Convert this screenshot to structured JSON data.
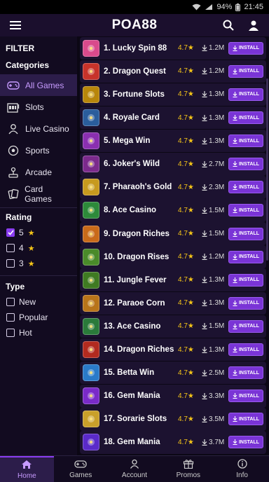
{
  "status_bar": {
    "battery": "94%",
    "time": "21:45"
  },
  "header": {
    "title": "POA88",
    "menu_icon": "hamburger-icon",
    "search_icon": "search-icon",
    "user_icon": "user-icon"
  },
  "sidebar": {
    "filter_heading": "FILTER",
    "categories_heading": "Categories",
    "categories": [
      {
        "label": "All Games",
        "icon": "gamepad-icon",
        "active": true
      },
      {
        "label": "Slots",
        "icon": "slot-machine-icon",
        "active": false
      },
      {
        "label": "Live Casino",
        "icon": "dealer-icon",
        "active": false
      },
      {
        "label": "Sports",
        "icon": "soccer-ball-icon",
        "active": false
      },
      {
        "label": "Arcade",
        "icon": "joystick-icon",
        "active": false
      },
      {
        "label": "Card Games",
        "icon": "cards-icon",
        "active": false
      }
    ],
    "rating_heading": "Rating",
    "ratings": [
      {
        "label": "5",
        "checked": true
      },
      {
        "label": "4",
        "checked": false
      },
      {
        "label": "3",
        "checked": false
      }
    ],
    "type_heading": "Type",
    "types": [
      {
        "label": "New",
        "checked": false
      },
      {
        "label": "Popular",
        "checked": false
      },
      {
        "label": "Hot",
        "checked": false
      }
    ]
  },
  "games": [
    {
      "name": "1. Lucky Spin 88",
      "rating": "4.7",
      "downloads": "1.2M",
      "install_label": "INSTALL",
      "thumb_color": "#d94a8c"
    },
    {
      "name": "2. Dragon Quest",
      "rating": "4.7",
      "downloads": "1.2M",
      "install_label": "INSTALL",
      "thumb_color": "#c7332a"
    },
    {
      "name": "3. Fortune Slots",
      "rating": "4.7",
      "downloads": "1.3M",
      "install_label": "INSTALL",
      "thumb_color": "#b8860b"
    },
    {
      "name": "4. Royale Card",
      "rating": "4.7",
      "downloads": "1.3M",
      "install_label": "INSTALL",
      "thumb_color": "#2a5d9c"
    },
    {
      "name": "5. Mega Win",
      "rating": "4.7",
      "downloads": "1.3M",
      "install_label": "INSTALL",
      "thumb_color": "#8a2fb0"
    },
    {
      "name": "6. Joker's Wild",
      "rating": "4.7",
      "downloads": "2.7M",
      "install_label": "INSTALL",
      "thumb_color": "#7b2a8c"
    },
    {
      "name": "7. Pharaoh's Gold",
      "rating": "4.7",
      "downloads": "2.3M",
      "install_label": "INSTALL",
      "thumb_color": "#c79a1f"
    },
    {
      "name": "8. Ace Casino",
      "rating": "4.7",
      "downloads": "1.5M",
      "install_label": "INSTALL",
      "thumb_color": "#2d8a3a"
    },
    {
      "name": "9. Dragon Riches",
      "rating": "4.7",
      "downloads": "1.5M",
      "install_label": "INSTALL",
      "thumb_color": "#c96a1a"
    },
    {
      "name": "10. Dragon Rises",
      "rating": "4.7",
      "downloads": "1.2M",
      "install_label": "INSTALL",
      "thumb_color": "#4a8a2a"
    },
    {
      "name": "11. Jungle Fever",
      "rating": "4.7",
      "downloads": "1.3M",
      "install_label": "INSTALL",
      "thumb_color": "#3f7a22"
    },
    {
      "name": "12. Paraoe Corn",
      "rating": "4.7",
      "downloads": "1.3M",
      "install_label": "INSTALL",
      "thumb_color": "#b8741a"
    },
    {
      "name": "13. Ace Casino",
      "rating": "4.7",
      "downloads": "1.5M",
      "install_label": "INSTALL",
      "thumb_color": "#2a7a3a"
    },
    {
      "name": "14. Dragon Riches",
      "rating": "4.7",
      "downloads": "1.3M",
      "install_label": "INSTALL",
      "thumb_color": "#b22a1f"
    },
    {
      "name": "15. Betta Win",
      "rating": "4.7",
      "downloads": "2.5M",
      "install_label": "INSTALL",
      "thumb_color": "#2a7ac9"
    },
    {
      "name": "16. Gem Mania",
      "rating": "4.7",
      "downloads": "3.3M",
      "install_label": "INSTALL",
      "thumb_color": "#7a2ac9"
    },
    {
      "name": "17. Sorarie Slots",
      "rating": "4.7",
      "downloads": "3.5M",
      "install_label": "INSTALL",
      "thumb_color": "#c9a02a"
    },
    {
      "name": "18. Gem Mania",
      "rating": "4.7",
      "downloads": "3.7M",
      "install_label": "INSTALL",
      "thumb_color": "#5a2ac9"
    }
  ],
  "bottom_nav": [
    {
      "label": "Home",
      "icon": "home-icon",
      "active": true
    },
    {
      "label": "Games",
      "icon": "gamepad-icon",
      "active": false
    },
    {
      "label": "Account",
      "icon": "user-icon",
      "active": false
    },
    {
      "label": "Promos",
      "icon": "gift-icon",
      "active": false
    },
    {
      "label": "Info",
      "icon": "info-icon",
      "active": false
    }
  ]
}
